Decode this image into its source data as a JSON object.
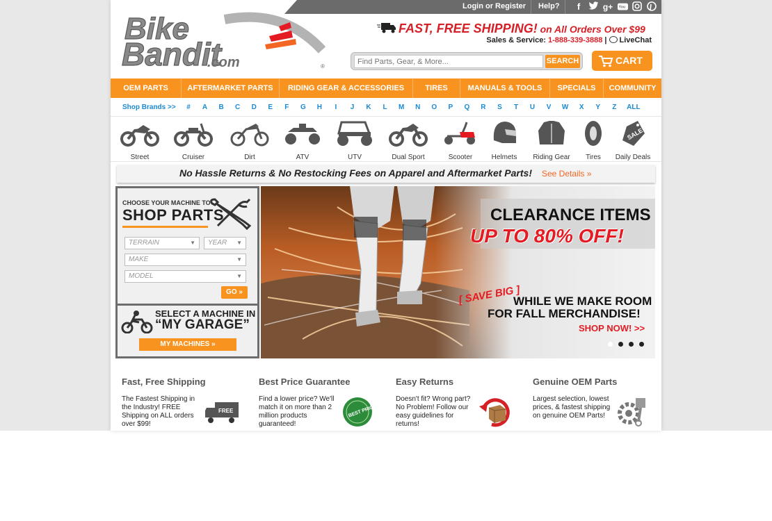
{
  "topbar": {
    "login": "Login or Register",
    "help": "Help?",
    "social": [
      "facebook-icon",
      "twitter-icon",
      "google-plus-icon",
      "youtube-icon",
      "instagram-icon",
      "pinterest-icon"
    ]
  },
  "logo": {
    "line1": "Bike",
    "line2": "Bandit",
    "tld": ".com",
    "mark": "®"
  },
  "header": {
    "shipping_main": "FAST, FREE SHIPPING!",
    "shipping_suffix": " on All Orders Over $99",
    "sales_label": "Sales & Service: ",
    "phone": "1-888-339-3888",
    "divider": " | ",
    "livechat": "LiveChat"
  },
  "search": {
    "placeholder": "Find Parts, Gear, & More...",
    "button": "SEARCH"
  },
  "cart": {
    "label": "CART"
  },
  "nav": [
    "OEM PARTS",
    "AFTERMARKET PARTS",
    "RIDING GEAR & ACCESSORIES",
    "TIRES",
    "MANUALS & TOOLS",
    "SPECIALS",
    "COMMUNITY"
  ],
  "brands": {
    "label": "Shop Brands >>",
    "letters": [
      "#",
      "A",
      "B",
      "C",
      "D",
      "E",
      "F",
      "G",
      "H",
      "I",
      "J",
      "K",
      "L",
      "M",
      "N",
      "O",
      "P",
      "Q",
      "R",
      "S",
      "T",
      "U",
      "V",
      "W",
      "X",
      "Y",
      "Z",
      "ALL"
    ]
  },
  "machines": [
    "Street",
    "Cruiser",
    "Dirt",
    "ATV",
    "UTV",
    "Dual Sport",
    "Scooter",
    "Helmets",
    "Riding Gear",
    "Tires",
    "Daily Deals"
  ],
  "returns": {
    "text": "No Hassle Returns & No Restocking Fees on Apparel and Aftermarket Parts!",
    "link": "See Details »"
  },
  "shop_parts": {
    "choose": "CHOOSE YOUR MACHINE TO",
    "title": "SHOP PARTS",
    "terrain": "TERRAIN",
    "year": "YEAR",
    "make": "MAKE",
    "model": "MODEL",
    "go": "GO »"
  },
  "garage": {
    "line1": "SELECT A MACHINE IN",
    "line2": "“MY GARAGE”",
    "button": "MY MACHINES »"
  },
  "hero": {
    "title": "CLEARANCE ITEMS",
    "subtitle": "UP TO 80% OFF!",
    "save_big": "[ SAVE BIG ]",
    "line1": "WHILE WE MAKE ROOM",
    "line2": "FOR FALL MERCHANDISE!",
    "cta": "SHOP NOW! >>",
    "slides": 4,
    "active_slide": 1
  },
  "features": [
    {
      "title": "Fast, Free Shipping",
      "desc": "The Fastest Shipping in the Industry! FREE Shipping on ALL orders over $99!",
      "icon": "truck-icon",
      "badge": "FREE"
    },
    {
      "title": "Best Price Guarantee",
      "desc": "Find a lower price? We'll match it on more than 2 million products guaranteed!",
      "icon": "price-seal-icon",
      "badge": "BEST PRICE"
    },
    {
      "title": "Easy Returns",
      "desc": "Doesn't fit? Wrong part? No Problem! Follow our easy guidelines for returns!",
      "icon": "return-box-icon"
    },
    {
      "title": "Genuine OEM Parts",
      "desc": "Largest selection, lowest prices, & fastest shipping on genuine OEM Parts!",
      "icon": "gear-piston-icon"
    }
  ],
  "colors": {
    "orange": "#f7931e",
    "red": "#d42027",
    "link_blue": "#1a8ad4",
    "topbar": "#6b6b6b"
  }
}
